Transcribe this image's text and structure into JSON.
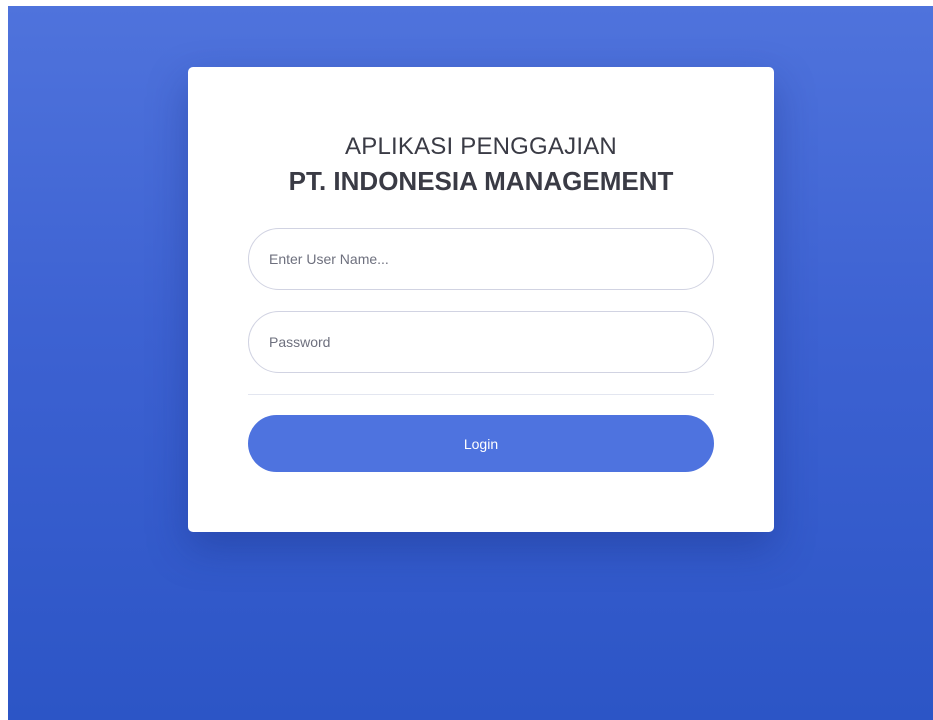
{
  "login": {
    "title_line1": "APLIKASI PENGGAJIAN",
    "title_line2": "PT. INDONESIA MANAGEMENT",
    "username_placeholder": "Enter User Name...",
    "username_value": "",
    "password_placeholder": "Password",
    "password_value": "",
    "login_label": "Login"
  },
  "colors": {
    "background_top": "#4f73dc",
    "background_bottom": "#2c55c6",
    "card": "#ffffff",
    "button": "#4e73df",
    "text": "#3a3b45"
  }
}
